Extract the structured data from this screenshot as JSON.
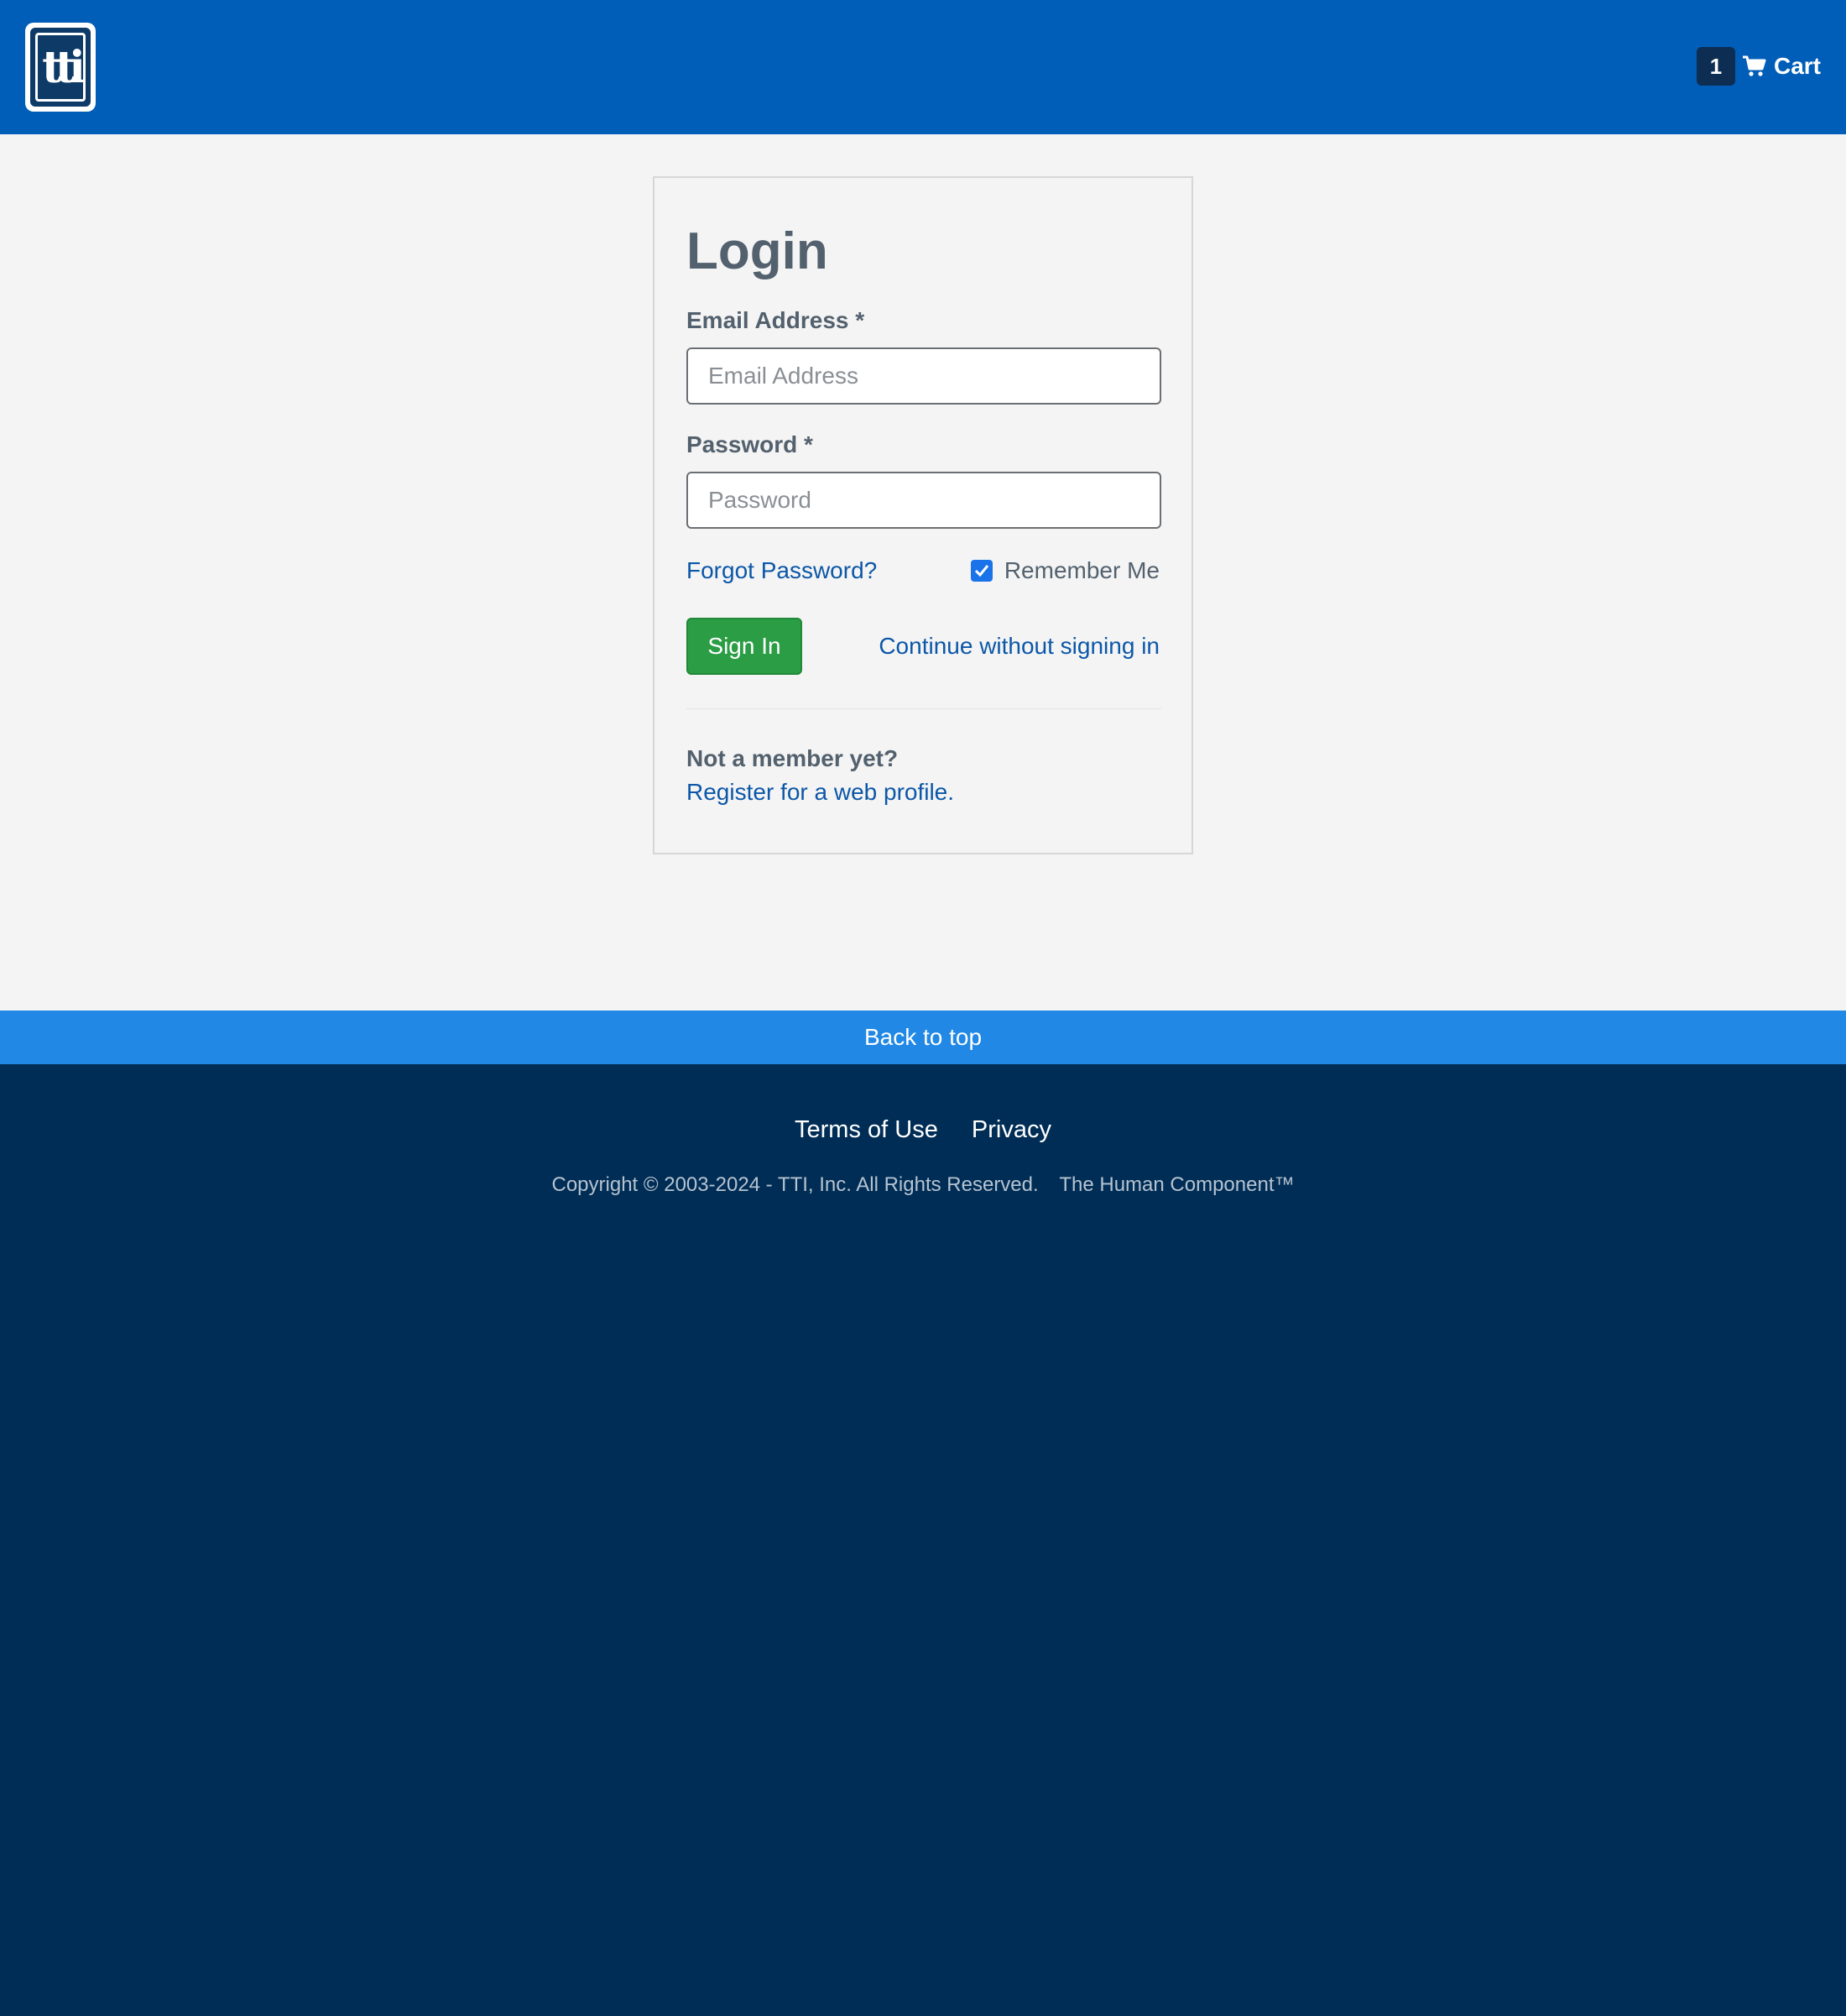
{
  "header": {
    "logo_text": "tti",
    "cart": {
      "count": "1",
      "label": "Cart",
      "icon": "shopping-cart-icon"
    }
  },
  "login": {
    "title": "Login",
    "email_label": "Email Address *",
    "email_placeholder": "Email Address",
    "email_value": "",
    "password_label": "Password *",
    "password_placeholder": "Password",
    "password_value": "",
    "forgot_password": "Forgot Password?",
    "remember_me": "Remember Me",
    "remember_checked": true,
    "sign_in": "Sign In",
    "continue_without": "Continue without signing in",
    "not_member": "Not a member yet?",
    "register": "Register for a web profile."
  },
  "back_to_top": "Back to top",
  "footer": {
    "links": [
      "Terms of Use",
      "Privacy"
    ],
    "copyright": "Copyright © 2003-2024 - TTI, Inc. All Rights Reserved.",
    "tagline": "The Human Component™"
  },
  "colors": {
    "header_bg": "#005eb8",
    "back_to_top_bg": "#2188e6",
    "footer_bg": "#002d55",
    "sign_in_bg": "#2a9d45",
    "link": "#0b57a8"
  }
}
